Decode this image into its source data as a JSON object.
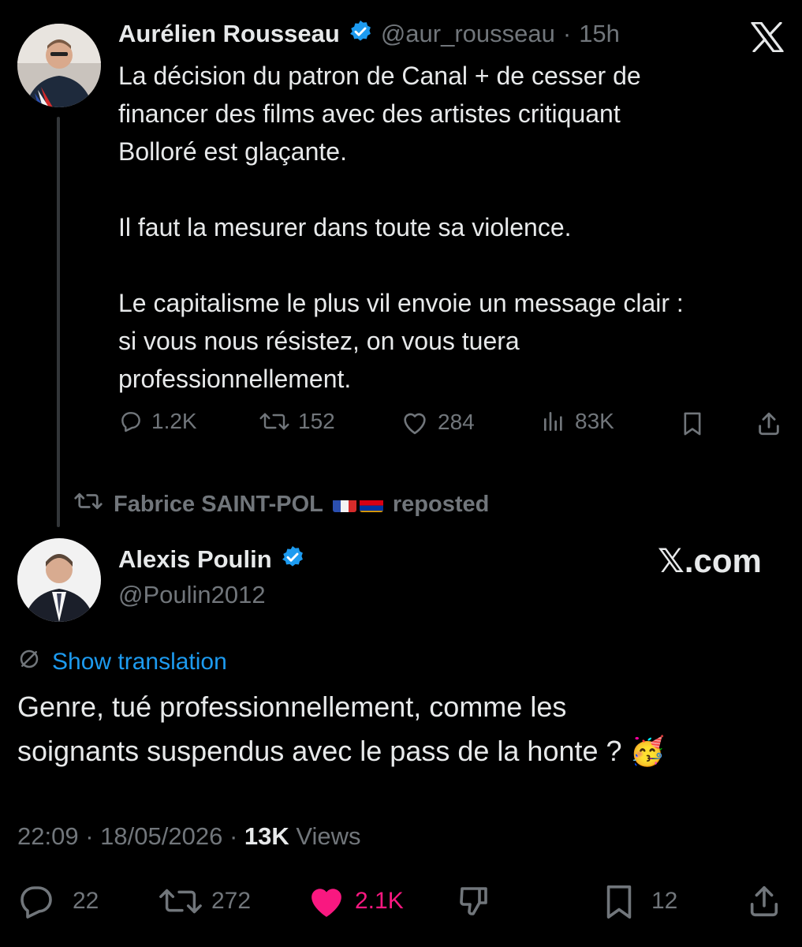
{
  "original_tweet": {
    "author_name": "Aurélien Rousseau",
    "handle": "@aur_rousseau",
    "separator": "·",
    "time_ago": "15h",
    "text": "La décision du patron de Canal + de cesser de\nfinancer des films avec des artistes critiquant\nBolloré est glaçante.\n\nIl faut la mesurer dans toute sa violence.\n\nLe capitalisme le plus vil envoie un message clair :\nsi vous nous résistez, on vous tuera\nprofessionnellement.",
    "stats": {
      "replies": "1.2K",
      "reposts": "152",
      "likes": "284",
      "views": "83K"
    }
  },
  "repost_banner": {
    "user": "Fabrice SAINT-POL",
    "suffix": "reposted"
  },
  "reply_tweet": {
    "author_name": "Alexis Poulin",
    "handle": "@Poulin2012",
    "watermark": "𝕏.com",
    "show_translation": "Show translation",
    "text": "Genre, tué professionnellement, comme les\nsoignants suspendus avec le pass de la honte ? 🥳",
    "time": "22:09",
    "date": "18/05/2026",
    "views_count": "13K",
    "views_label": "Views",
    "stats": {
      "replies": "22",
      "reposts": "272",
      "likes": "2.1K",
      "bookmarks": "12"
    }
  },
  "colors": {
    "accent": "#1d9bf0",
    "like": "#f91880",
    "muted": "#71767b",
    "text": "#e7e9ea",
    "background": "#000000"
  }
}
